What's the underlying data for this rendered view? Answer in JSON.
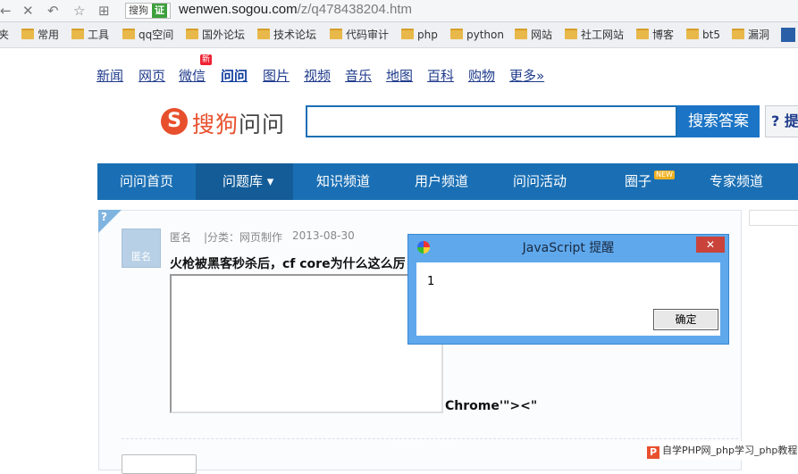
{
  "browser": {
    "url_host": "wenwen.sogou.com",
    "url_path": "/z/q478438204.htm",
    "sogou_badge": "搜狗",
    "verified_badge": "证"
  },
  "bookmarks": [
    {
      "label": "夹"
    },
    {
      "label": "常用"
    },
    {
      "label": "工具"
    },
    {
      "label": "qq空间"
    },
    {
      "label": "国外论坛"
    },
    {
      "label": "技术论坛"
    },
    {
      "label": "代码审计"
    },
    {
      "label": "php"
    },
    {
      "label": "python"
    },
    {
      "label": "网站"
    },
    {
      "label": "社工网站"
    },
    {
      "label": "博客"
    },
    {
      "label": "bt5"
    },
    {
      "label": "漏洞"
    }
  ],
  "topnav": [
    {
      "label": "新闻"
    },
    {
      "label": "网页"
    },
    {
      "label": "微信"
    },
    {
      "label": "问问"
    },
    {
      "label": "图片"
    },
    {
      "label": "视频"
    },
    {
      "label": "音乐"
    },
    {
      "label": "地图"
    },
    {
      "label": "百科"
    },
    {
      "label": "购物"
    },
    {
      "label": "更多»"
    }
  ],
  "topnav_new_badge": "新",
  "logo": {
    "mark": "S",
    "brand": "搜狗",
    "product": "问问"
  },
  "search": {
    "value": "",
    "button": "搜索答案",
    "ask_button": "? 提"
  },
  "menu": [
    {
      "label": "问问首页"
    },
    {
      "label": "问题库 ▾"
    },
    {
      "label": "知识频道"
    },
    {
      "label": "用户频道"
    },
    {
      "label": "问问活动"
    },
    {
      "label": "圈子"
    },
    {
      "label": "专家频道"
    }
  ],
  "menu_new_badge": "NEW",
  "question": {
    "corner_mark": "?",
    "avatar_label": "匿名",
    "author": "匿名",
    "category": "|分类：网页制作",
    "date": "2013-08-30",
    "title": "火枪被黑客秒杀后，cf core为什么这么厉",
    "trailing_text": "Chrome'\"><\""
  },
  "alert": {
    "title": "JavaScript 提醒",
    "message": "1",
    "ok_label": "确定",
    "close_label": "✕"
  },
  "watermark": {
    "icon": "P",
    "text": "自学PHP网_php学习_php教程"
  },
  "colors": {
    "accent": "#1a6fb4",
    "brand": "#e8502d"
  }
}
